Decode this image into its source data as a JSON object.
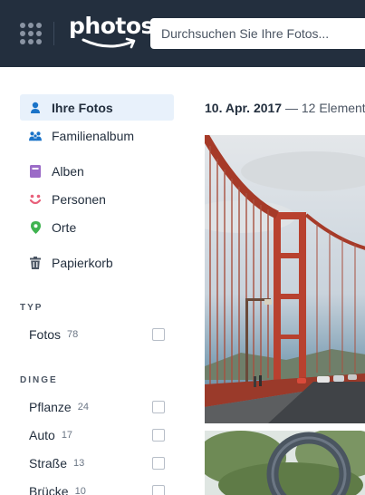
{
  "header": {
    "logo_text": "photos",
    "search_placeholder": "Durchsuchen Sie Ihre Fotos..."
  },
  "sidebar": {
    "nav": [
      {
        "label": "Ihre Fotos",
        "icon": "person-icon",
        "color": "#1a73c8",
        "active": true
      },
      {
        "label": "Familienalbum",
        "icon": "family-icon",
        "color": "#1a73c8"
      },
      {
        "label": "Alben",
        "icon": "album-icon",
        "color": "#9b6bc7"
      },
      {
        "label": "Personen",
        "icon": "face-icon",
        "color": "#e8607a"
      },
      {
        "label": "Orte",
        "icon": "location-pin-icon",
        "color": "#3fb34f"
      },
      {
        "label": "Papierkorb",
        "icon": "trash-icon",
        "color": "#4b5563"
      }
    ],
    "type_section": {
      "title": "TYP",
      "items": [
        {
          "label": "Fotos",
          "count": "78"
        }
      ]
    },
    "things_section": {
      "title": "DINGE",
      "items": [
        {
          "label": "Pflanze",
          "count": "24"
        },
        {
          "label": "Auto",
          "count": "17"
        },
        {
          "label": "Straße",
          "count": "13"
        },
        {
          "label": "Brücke",
          "count": "10"
        }
      ]
    }
  },
  "main": {
    "date": "10. Apr. 2017",
    "count_text": " — 12 Elemente"
  },
  "colors": {
    "header_bg": "#232f3e",
    "active_bg": "#e8f1fb",
    "accent_blue": "#1a73c8"
  }
}
